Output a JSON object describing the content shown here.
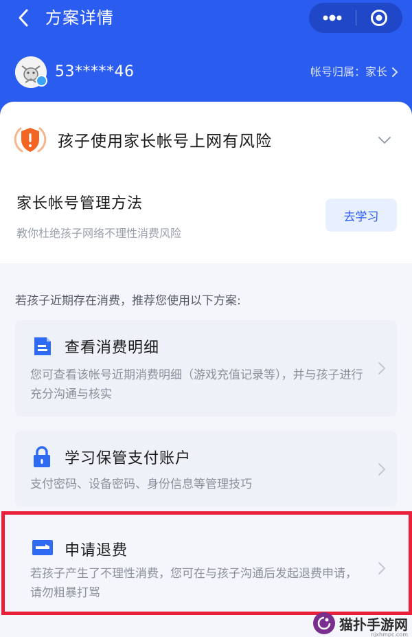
{
  "header": {
    "title": "方案详情",
    "back_icon": "chevron-left-icon",
    "more_icon": "more-dots-icon",
    "close_icon": "target-circle-icon",
    "bg_color": "#2a5cf0"
  },
  "account": {
    "id": "53*****46",
    "owner": "帐号归属：家长"
  },
  "risk": {
    "title": "孩子使用家长帐号上网有风险",
    "icon": "shield-warning-icon"
  },
  "manage": {
    "title": "家长帐号管理方法",
    "subtitle": "教你杜绝孩子网络不理性消费风险",
    "button": "去学习"
  },
  "intro": "若孩子近期存在消费，推荐您使用以下方案:",
  "plans": [
    {
      "title": "查看消费明细",
      "desc": "您可查看该帐号近期消费明细（游戏充值记录等），并与孩子进行充分沟通与核实",
      "icon": "document-icon"
    },
    {
      "title": "学习保管支付账户",
      "desc": "支付密码、设备密码、身份信息等管理技巧",
      "icon": "lock-icon"
    },
    {
      "title": "申请退费",
      "desc": "若孩子产生了不理性消费，您可在与孩子沟通后发起退费申请，请勿粗暴打骂",
      "icon": "card-icon"
    }
  ],
  "watermark": {
    "text": "猫扑手游网",
    "url": "njxhmpc.com"
  },
  "colors": {
    "accent": "#2a5cf0",
    "highlight": "#e8203a",
    "warning": "#f26522"
  }
}
